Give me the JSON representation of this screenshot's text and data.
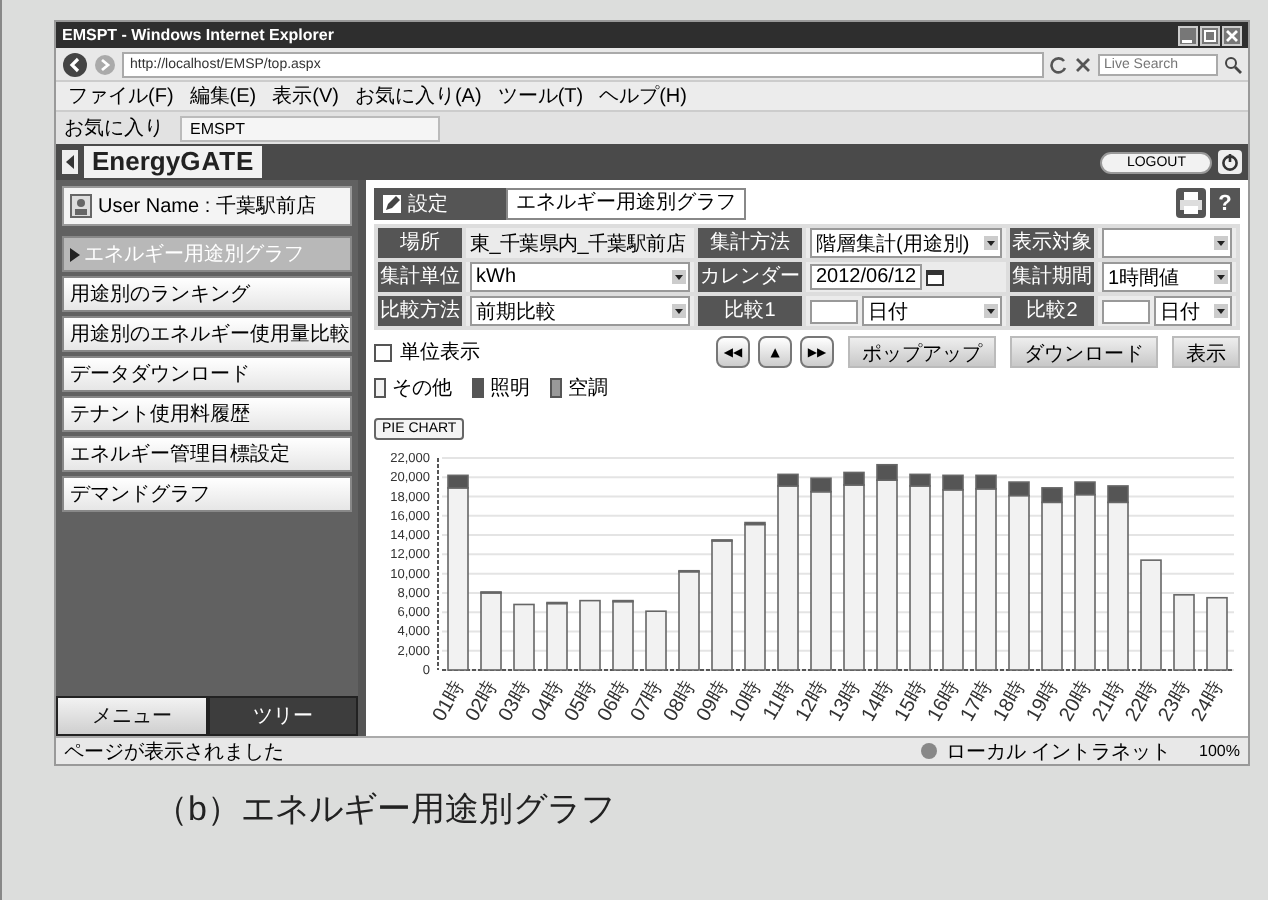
{
  "browser": {
    "title": "EMSPT - Windows Internet Explorer",
    "address": "http://localhost/EMSP/top.aspx",
    "search": {
      "placeholder": "Live Search"
    },
    "menu": [
      "ファイル(F)",
      "編集(E)",
      "表示(V)",
      "お気に入り(A)",
      "ツール(T)",
      "ヘルプ(H)"
    ],
    "favorites": "お気に入り",
    "tab": "EMSPT"
  },
  "app": {
    "logo_left": "Energy",
    "logo_right": "GATE",
    "logout": "LOGOUT"
  },
  "sidebar": {
    "user": "User Name : 千葉駅前店",
    "items": [
      {
        "label": "エネルギー用途別グラフ",
        "selected": true
      },
      {
        "label": "用途別のランキング",
        "selected": false
      },
      {
        "label": "用途別のエネルギー使用量比較",
        "selected": false
      },
      {
        "label": "データダウンロード",
        "selected": false
      },
      {
        "label": "テナント使用料履歴",
        "selected": false
      },
      {
        "label": "エネルギー管理目標設定",
        "selected": false
      },
      {
        "label": "デマンドグラフ",
        "selected": false
      }
    ],
    "tabs": [
      {
        "label": "メニュー",
        "selected": true
      },
      {
        "label": "ツリー",
        "selected": false
      }
    ]
  },
  "main": {
    "setting_label": "設定",
    "setting_value": "エネルギー用途別グラフ",
    "help": "?",
    "form": [
      [
        {
          "label": "場所",
          "kind": "text",
          "value": "東_千葉県内_千葉駅前店"
        },
        {
          "label": "集計方法",
          "kind": "select",
          "value": "階層集計(用途別)"
        },
        {
          "label": "表示対象",
          "kind": "select"
        }
      ],
      [
        {
          "label": "集計単位",
          "kind": "select",
          "value": "kWh"
        },
        {
          "label": "カレンダー",
          "kind": "date",
          "value": "2012/06/12"
        },
        {
          "label": "集計期間",
          "kind": "select",
          "value": "1時間値"
        }
      ],
      [
        {
          "label": "比較方法",
          "kind": "select",
          "value": "前期比較"
        },
        {
          "label": "比較1",
          "kind": "compare",
          "value": "日付"
        },
        {
          "label": "比較2",
          "kind": "compare",
          "value": "日付"
        }
      ]
    ],
    "unit_display": {
      "label": "単位表示",
      "checked": false
    },
    "nav": [
      "◀◀",
      "▲",
      "▶▶"
    ],
    "buttons": [
      "ポップアップ",
      "ダウンロード",
      "表示"
    ],
    "pie_chart_button": "PIE CHART",
    "chart_data": {
      "type": "bar",
      "stacked": true,
      "grid": true,
      "categories": [
        "01時",
        "02時",
        "03時",
        "04時",
        "05時",
        "06時",
        "07時",
        "08時",
        "09時",
        "10時",
        "11時",
        "12時",
        "13時",
        "14時",
        "15時",
        "16時",
        "17時",
        "18時",
        "19時",
        "20時",
        "21時",
        "22時",
        "23時",
        "24時"
      ],
      "series": [
        {
          "name": "その他",
          "color": "#f2f2f2",
          "values": [
            18900,
            8000,
            6800,
            6900,
            7200,
            7100,
            6100,
            10200,
            13400,
            15100,
            19100,
            18500,
            19200,
            19700,
            19100,
            18700,
            18800,
            18100,
            17400,
            18200,
            17400,
            11400,
            7800,
            7500
          ]
        },
        {
          "name": "照明",
          "color": "#555555",
          "values": [
            1300,
            100,
            0,
            100,
            0,
            100,
            0,
            100,
            100,
            200,
            1200,
            1400,
            1300,
            1600,
            1200,
            1500,
            1400,
            1400,
            1500,
            1300,
            1700,
            0,
            0,
            0
          ]
        },
        {
          "name": "空調",
          "color": "#999999",
          "values": [
            0,
            0,
            0,
            0,
            0,
            0,
            0,
            0,
            0,
            0,
            0,
            0,
            0,
            0,
            0,
            0,
            0,
            0,
            0,
            0,
            0,
            0,
            0,
            0
          ]
        }
      ],
      "ylim": [
        0,
        22000
      ],
      "yticks": [
        {
          "value": 0,
          "label": "0"
        },
        {
          "value": 2000,
          "label": "2,000"
        },
        {
          "value": 4000,
          "label": "4,000"
        },
        {
          "value": 6000,
          "label": "6,000"
        },
        {
          "value": 8000,
          "label": "8,000"
        },
        {
          "value": 10000,
          "label": "10,000"
        },
        {
          "value": 12000,
          "label": "12,000"
        },
        {
          "value": 14000,
          "label": "14,000"
        },
        {
          "value": 16000,
          "label": "16,000"
        },
        {
          "value": 18000,
          "label": "18,000"
        },
        {
          "value": 20000,
          "label": "20,000"
        },
        {
          "value": 22000,
          "label": "22,000"
        }
      ]
    }
  },
  "status_bar": {
    "text": "ページが表示されました",
    "zone": "ローカル イントラネット",
    "zoom": "100%"
  },
  "caption": "（b）エネルギー用途別グラフ"
}
